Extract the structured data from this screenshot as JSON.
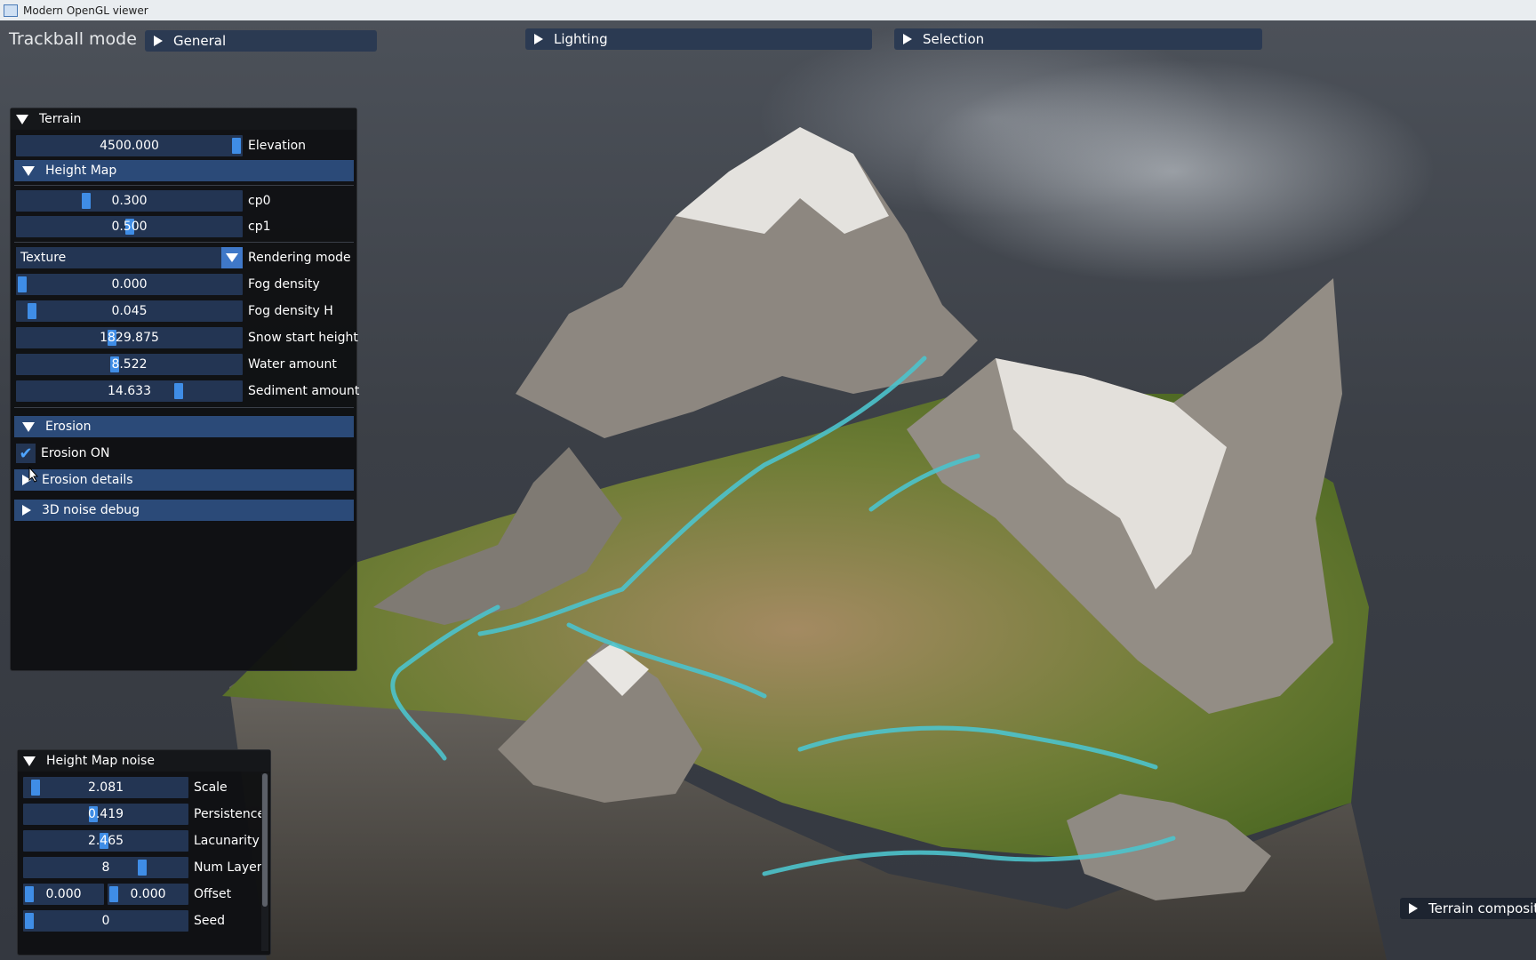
{
  "window": {
    "title": "Modern OpenGL viewer"
  },
  "mode_label": "Trackball mode",
  "top_headers": {
    "general": "General",
    "lighting": "Lighting",
    "selection": "Selection"
  },
  "terrain_panel": {
    "title": "Terrain",
    "elevation": {
      "value": "4500.000",
      "label": "Elevation",
      "fraction": 1.0
    },
    "height_map": {
      "title": "Height Map",
      "cp0": {
        "value": "0.300",
        "label": "cp0",
        "fraction": 0.3
      },
      "cp1": {
        "value": "0.500",
        "label": "cp1",
        "fraction": 0.5
      }
    },
    "rendering_mode": {
      "value": "Texture",
      "label": "Rendering mode"
    },
    "fog_density": {
      "value": "0.000",
      "label": "Fog density",
      "fraction": 0.0
    },
    "fog_density_h": {
      "value": "0.045",
      "label": "Fog density H",
      "fraction": 0.045
    },
    "snow_start_height": {
      "value": "1829.875",
      "label": "Snow start height",
      "fraction": 0.42
    },
    "water_amount": {
      "value": "8.522",
      "label": "Water amount",
      "fraction": 0.43
    },
    "sediment_amount": {
      "value": "14.633",
      "label": "Sediment amount",
      "fraction": 0.73
    },
    "erosion": {
      "title": "Erosion",
      "erosion_on": {
        "label": "Erosion ON",
        "checked": true
      },
      "details": "Erosion details"
    },
    "noise_debug": "3D noise debug"
  },
  "noise_panel": {
    "title": "Height Map noise",
    "scale": {
      "value": "2.081",
      "label": "Scale",
      "fraction": 0.04
    },
    "persistence": {
      "value": "0.419",
      "label": "Persistence",
      "fraction": 0.42
    },
    "lacunarity": {
      "value": "2.465",
      "label": "Lacunarity",
      "fraction": 0.49
    },
    "num_layer": {
      "value": "8",
      "label": "Num Layer",
      "fraction": 0.74
    },
    "offset": {
      "value_x": "0.000",
      "value_y": "0.000",
      "label": "Offset"
    },
    "seed": {
      "value": "0",
      "label": "Seed",
      "fraction": 0.0
    }
  },
  "terrain_composition": "Terrain composition",
  "colors": {
    "slider_bg": "#233553",
    "grab": "#3f8de6",
    "section_bg": "#2b4a78",
    "water": "#4cc3cc",
    "grass": "#5a7a2c",
    "rock": "#8a8580",
    "snow": "#e6e4e0"
  },
  "icons": {
    "collapsed": "triangle-right-icon",
    "expanded": "triangle-down-icon",
    "dropdown": "dropdown-arrow-icon",
    "check": "checkmark-icon"
  }
}
